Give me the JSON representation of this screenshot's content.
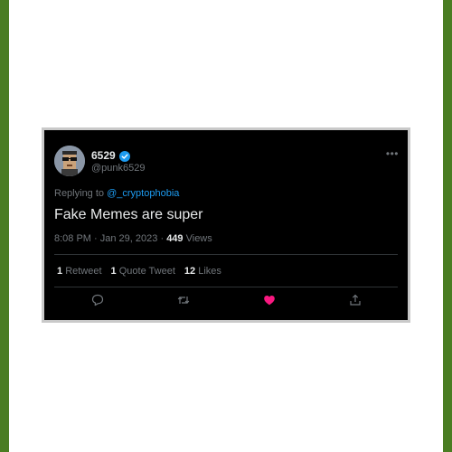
{
  "tweet": {
    "display_name": "6529",
    "handle": "@punk6529",
    "verified": true,
    "reply_prefix": "Replying to",
    "reply_to": "@_cryptophobia",
    "text": "Fake Memes are super",
    "time": "8:08 PM",
    "date": "Jan 29, 2023",
    "views_count": "449",
    "views_label": "Views",
    "retweets_count": "1",
    "retweets_label": "Retweet",
    "quotes_count": "1",
    "quotes_label": "Quote Tweet",
    "likes_count": "12",
    "likes_label": "Likes"
  },
  "icons": {
    "more": "more-icon",
    "reply": "reply-icon",
    "retweet": "retweet-icon",
    "like": "heart-icon",
    "share": "share-icon",
    "verified": "verified-badge-icon"
  },
  "colors": {
    "frame_green": "#4a7d22",
    "accent_blue": "#1d9bf0",
    "like_pink": "#f91880",
    "tweet_bg": "#000000",
    "muted_text": "#71767b"
  }
}
